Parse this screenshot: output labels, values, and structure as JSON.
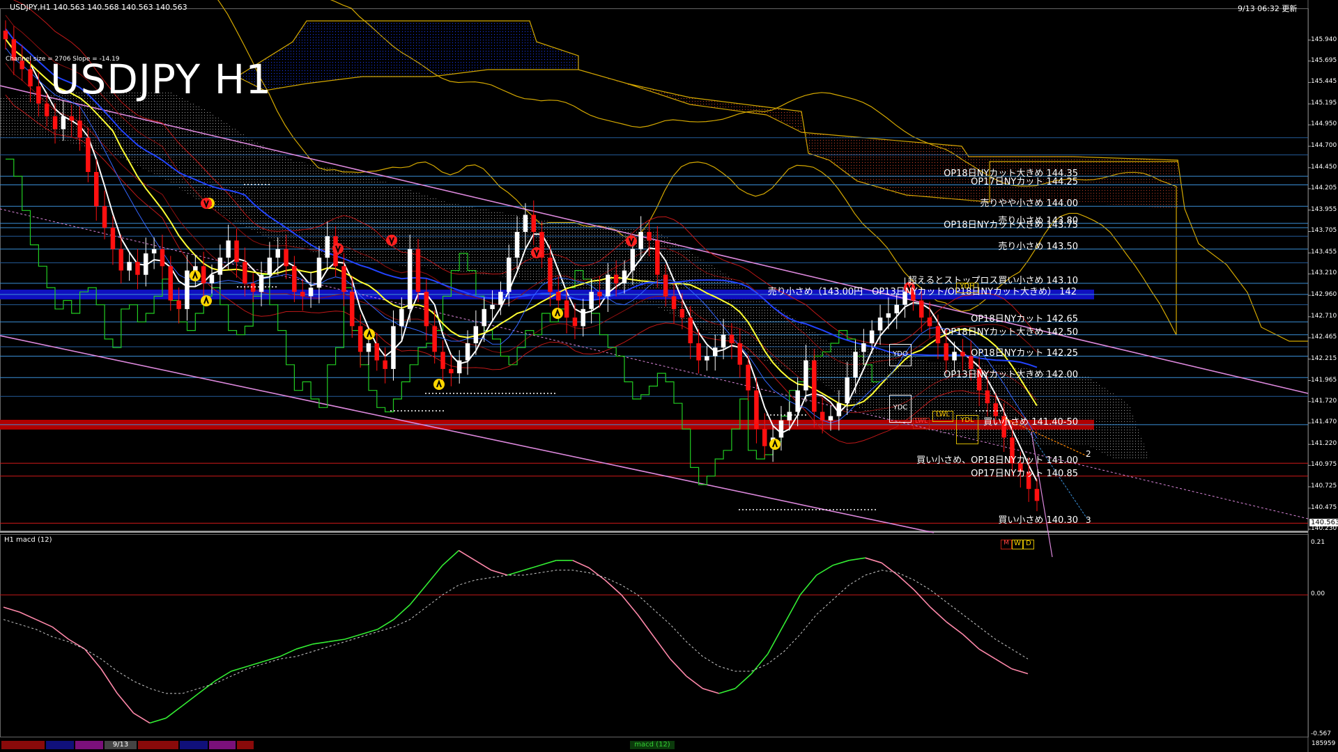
{
  "header": {
    "symbol_info": "USDJPY,H1  140.563 140.568 140.563 140.563",
    "timestamp": "9/13 06:32 更新",
    "channel_info": "Channel size = 2706 Slope = -14.19",
    "big_title": "USDJPY H1",
    "sub_window_label": "H1  macd (12)"
  },
  "levels": [
    {
      "label": "OP18日NYカット大きめ 144.35",
      "price": 144.35
    },
    {
      "label": "OP17日NYカット 144.25",
      "price": 144.25
    },
    {
      "label": "売りやや小さめ 144.00",
      "price": 144.0
    },
    {
      "label": "売り小さめ 143.80",
      "price": 143.8
    },
    {
      "label": "OP18日NYカット大きめ 143.75",
      "price": 143.75
    },
    {
      "label": "売り小さめ 143.50",
      "price": 143.5
    },
    {
      "label": "超えるとストップロス買い小さめ 143.10",
      "price": 143.1
    },
    {
      "label": "売り小さめ（143.00円　OP13日NYカット/OP18日NYカット大きめ） 142",
      "price": 142.97
    },
    {
      "label": "OP18日NYカット 142.65",
      "price": 142.65
    },
    {
      "label": "OP18日NYカット大きめ 142.50",
      "price": 142.5
    },
    {
      "label": "OP18日NYカット 142.25",
      "price": 142.25
    },
    {
      "label": "OP13日NYカット大きめ 142.00",
      "price": 142.0
    },
    {
      "label": "買い小さめ 141.40-50",
      "price": 141.45
    },
    {
      "label": "買い小さめ、OP18日NYカット 141.00",
      "price": 141.0
    },
    {
      "label": "OP17日NYカット 140.85",
      "price": 140.85
    },
    {
      "label": "買い小さめ 140.30",
      "price": 140.3
    }
  ],
  "boxes": {
    "ydh": "YDH",
    "ydo": "YDO",
    "ydc": "YDC",
    "lwl": "LWL",
    "ydl": "YDL",
    "m": "M",
    "w": "W",
    "d": "D"
  },
  "price_tag": "140.563",
  "wave_labels": {
    "two": "2",
    "three": "3"
  },
  "date_label": "9/13",
  "tab_label": "macd (12)",
  "colors": {
    "background": "#000000",
    "cloud_blue": "#1a3cff",
    "cloud_red": "#d0442a",
    "sma_yellow": "#ffff33",
    "ema_white": "#ffffff",
    "ema_blue": "#2244ff",
    "chikou_green": "#22cc22",
    "channel_pink": "#dd88dd",
    "bull": "#ffffff",
    "bear": "#ff1010",
    "macd_green": "#33ee33",
    "macd_pink": "#ff88aa",
    "signal": "#cccccc"
  },
  "chart_data": [
    {
      "type": "candlestick",
      "title": "USDJPY H1",
      "ylim": [
        140.23,
        146.18
      ],
      "yticks": [
        145.94,
        145.695,
        145.445,
        145.195,
        144.95,
        144.7,
        144.45,
        144.205,
        143.955,
        143.705,
        143.455,
        143.21,
        142.96,
        142.71,
        142.465,
        142.215,
        141.965,
        141.72,
        141.47,
        141.22,
        140.975,
        140.725,
        140.475,
        140.23
      ],
      "last_price": 140.563,
      "close": [
        145.95,
        145.7,
        145.6,
        145.4,
        145.2,
        145.05,
        144.9,
        145.05,
        145.0,
        144.8,
        144.4,
        144.0,
        143.75,
        143.5,
        143.25,
        143.35,
        143.2,
        143.45,
        143.5,
        143.3,
        142.9,
        142.8,
        143.25,
        143.3,
        143.1,
        143.2,
        143.4,
        143.6,
        143.35,
        143.1,
        143.0,
        143.2,
        143.4,
        143.5,
        143.3,
        143.0,
        142.95,
        143.05,
        143.4,
        143.65,
        143.3,
        143.0,
        142.6,
        142.3,
        142.4,
        142.2,
        142.1,
        142.6,
        142.8,
        143.5,
        143.0,
        142.6,
        142.3,
        142.1,
        142.05,
        142.2,
        142.4,
        142.6,
        142.8,
        142.85,
        143.0,
        143.4,
        143.7,
        143.9,
        143.7,
        143.4,
        143.0,
        142.9,
        142.7,
        142.6,
        142.8,
        143.0,
        142.95,
        143.2,
        143.1,
        143.25,
        143.5,
        143.7,
        143.6,
        143.2,
        142.95,
        142.8,
        142.7,
        142.4,
        142.2,
        142.25,
        142.35,
        142.5,
        142.4,
        142.15,
        141.85,
        141.4,
        141.2,
        141.3,
        141.5,
        141.6,
        141.85,
        142.2,
        141.6,
        141.5,
        141.55,
        141.7,
        142.0,
        142.3,
        142.4,
        142.55,
        142.7,
        142.75,
        142.85,
        143.0,
        142.9,
        142.7,
        142.6,
        142.4,
        142.2,
        142.3,
        142.25,
        142.1,
        141.85,
        141.7,
        141.55,
        141.3,
        141.0,
        140.9,
        140.7,
        140.56
      ]
    },
    {
      "type": "line",
      "title": "H1  macd (12)",
      "ylim": [
        -0.567,
        0.21
      ],
      "yticks": [
        0.21,
        0.0,
        -0.567
      ],
      "series": [
        {
          "name": "macd",
          "values": [
            -0.05,
            -0.07,
            -0.1,
            -0.13,
            -0.18,
            -0.22,
            -0.3,
            -0.4,
            -0.48,
            -0.52,
            -0.5,
            -0.45,
            -0.4,
            -0.35,
            -0.31,
            -0.29,
            -0.27,
            -0.25,
            -0.22,
            -0.2,
            -0.19,
            -0.18,
            -0.16,
            -0.14,
            -0.1,
            -0.04,
            0.04,
            0.12,
            0.18,
            0.14,
            0.1,
            0.08,
            0.1,
            0.12,
            0.14,
            0.14,
            0.11,
            0.06,
            0.0,
            -0.08,
            -0.17,
            -0.26,
            -0.33,
            -0.38,
            -0.4,
            -0.38,
            -0.32,
            -0.24,
            -0.12,
            0.0,
            0.08,
            0.12,
            0.14,
            0.15,
            0.13,
            0.08,
            0.02,
            -0.05,
            -0.11,
            -0.16,
            -0.22,
            -0.26,
            -0.3,
            -0.32
          ]
        },
        {
          "name": "signal",
          "values": [
            -0.1,
            -0.12,
            -0.14,
            -0.17,
            -0.19,
            -0.22,
            -0.26,
            -0.31,
            -0.35,
            -0.38,
            -0.4,
            -0.4,
            -0.38,
            -0.36,
            -0.33,
            -0.3,
            -0.28,
            -0.26,
            -0.25,
            -0.23,
            -0.21,
            -0.19,
            -0.17,
            -0.15,
            -0.13,
            -0.1,
            -0.05,
            0.0,
            0.04,
            0.06,
            0.07,
            0.08,
            0.08,
            0.09,
            0.1,
            0.1,
            0.09,
            0.07,
            0.04,
            0.0,
            -0.06,
            -0.12,
            -0.19,
            -0.25,
            -0.29,
            -0.31,
            -0.31,
            -0.28,
            -0.23,
            -0.16,
            -0.08,
            -0.02,
            0.04,
            0.08,
            0.1,
            0.09,
            0.06,
            0.02,
            -0.03,
            -0.08,
            -0.13,
            -0.18,
            -0.22,
            -0.26
          ]
        }
      ]
    }
  ]
}
